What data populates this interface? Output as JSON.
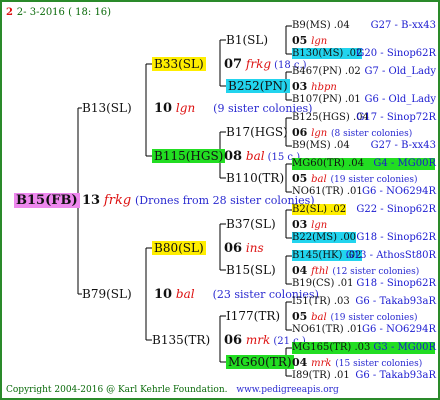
{
  "header": {
    "date": "2- 3-2016 ( 18: 16)"
  },
  "footer": {
    "copyright": "Copyright 2004-2016 @ Karl Kehrle Foundation.",
    "site": "www.pedigreeapis.org"
  },
  "root": {
    "id": "B15(FB)",
    "count": "13",
    "origin": "frkg",
    "note": "(Drones from 28 sister colonies)"
  },
  "l1": [
    {
      "id": "B13(SL)",
      "count": "10",
      "origin": "lgn",
      "note": "(9 sister colonies)"
    },
    {
      "id": "B79(SL)",
      "count": "10",
      "origin": "bal",
      "note": "(23 sister colonies)"
    }
  ],
  "l2": [
    {
      "id": "B33(SL)",
      "count": "07",
      "origin": "frkg",
      "note": "(18 c.)"
    },
    {
      "id": "B115(HGS)",
      "count": "08",
      "origin": "bal",
      "note": "(15 c.)"
    },
    {
      "id": "B80(SL)",
      "count": "06",
      "origin": "ins",
      "note": ""
    },
    {
      "id": "B135(TR)",
      "count": "06",
      "origin": "mrk",
      "note": "(21 c.)"
    }
  ],
  "l3": [
    {
      "id": "B1(SL)",
      "count": "05",
      "origin": "lgn",
      "note": ""
    },
    {
      "id": "B252(PN)",
      "count": "03",
      "origin": "hbpn",
      "note": ""
    },
    {
      "id": "B17(HGS)",
      "count": "06",
      "origin": "lgn",
      "note": "(8 sister colonies)"
    },
    {
      "id": "B110(TR)",
      "count": "05",
      "origin": "bal",
      "note": "(19 sister colonies)"
    },
    {
      "id": "B37(SL)",
      "count": "03",
      "origin": "lgn",
      "note": ""
    },
    {
      "id": "B15(SL)",
      "count": "04",
      "origin": "fthl",
      "note": "(12 sister colonies)"
    },
    {
      "id": "I177(TR)",
      "count": "05",
      "origin": "bal",
      "note": "(19 sister colonies)"
    },
    {
      "id": "MG60(TR)",
      "count": "04",
      "origin": "mrk",
      "note": "(15 sister colonies)"
    }
  ],
  "l4": [
    {
      "id": "B9(MS) .04",
      "ref": "G27 - B-xx43"
    },
    {
      "id": "B130(MS) .02",
      "ref": "G20 - Sinop62R"
    },
    {
      "id": "B467(PN) .02",
      "ref": "G7 - Old_Lady"
    },
    {
      "id": "B107(PN) .01",
      "ref": "G6 - Old_Lady"
    },
    {
      "id": "B125(HGS) .04",
      "ref": "G17 - Sinop72R"
    },
    {
      "id": "B9(MS) .04",
      "ref": "G27 - B-xx43"
    },
    {
      "id": "MG60(TR) .04",
      "ref": "G4 - MG00R"
    },
    {
      "id": "NO61(TR) .01",
      "ref": "G6 - NO6294R"
    },
    {
      "id": "B2(SL) .02",
      "ref": "G22 - Sinop62R"
    },
    {
      "id": "B22(MS) .00",
      "ref": "G18 - Sinop62R"
    },
    {
      "id": "B145(HK) .02",
      "ref": "G13 - AthosSt80R"
    },
    {
      "id": "B19(CS) .01",
      "ref": "G18 - Sinop62R"
    },
    {
      "id": "I51(TR) .03",
      "ref": "G6 - Takab93aR"
    },
    {
      "id": "NO61(TR) .01",
      "ref": "G6 - NO6294R"
    },
    {
      "id": "MG165(TR) .03",
      "ref": "G3 - MG00R"
    },
    {
      "id": "I89(TR) .01",
      "ref": "G6 - Takab93aR"
    }
  ]
}
